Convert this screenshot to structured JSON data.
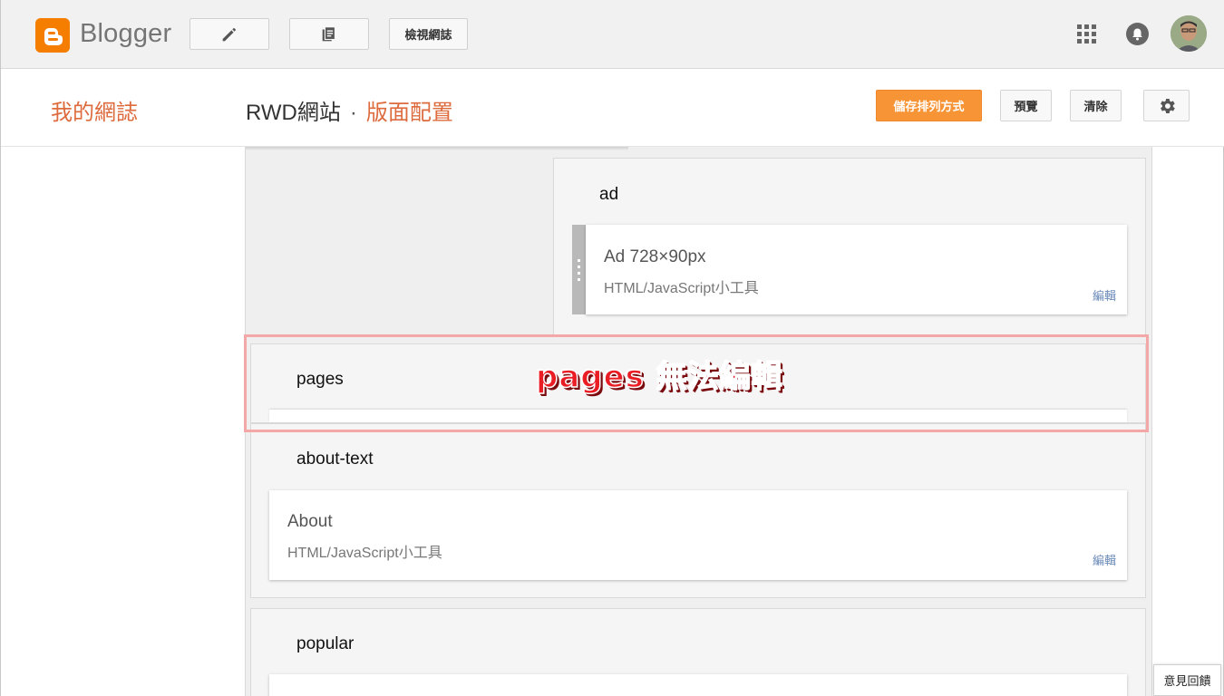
{
  "topbar": {
    "logo_text": "Blogger",
    "view_blog_label": "檢視網誌",
    "icons": {
      "logo": "blogger-logo-icon",
      "compose": "pencil-icon",
      "pages": "pages-icon",
      "apps": "apps-grid-icon",
      "notifications": "bell-icon",
      "avatar": "user-avatar"
    }
  },
  "header": {
    "my_blogs": "我的網誌",
    "blog_name": "RWD網站",
    "separator": "·",
    "page_name": "版面配置",
    "save_label": "儲存排列方式",
    "preview_label": "預覽",
    "clear_label": "清除",
    "settings_icon": "gear-icon"
  },
  "sections": {
    "ad": {
      "title": "ad",
      "widget": {
        "title": "Ad 728×90px",
        "type": "HTML/JavaScript小工具",
        "edit_label": "編輯"
      }
    },
    "pages": {
      "title": "pages"
    },
    "about": {
      "title": "about-text",
      "widget": {
        "title": "About",
        "type": "HTML/JavaScript小工具",
        "edit_label": "編輯"
      }
    },
    "popular": {
      "title": "popular"
    }
  },
  "annotation": {
    "text": "pages 無法編輯",
    "color": "#ea1c24",
    "highlight_color": "#f4a7a7"
  },
  "feedback_label": "意見回饋",
  "colors": {
    "brand_orange": "#f57d00",
    "accent_link": "#dd6b3d",
    "save_button": "#f79536"
  }
}
